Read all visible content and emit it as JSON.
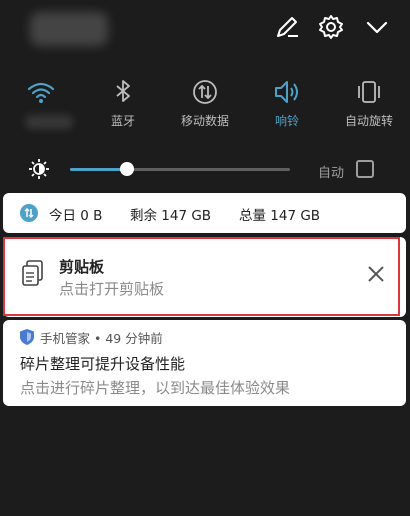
{
  "quick_settings": {
    "tiles": [
      {
        "label": "",
        "icon": "wifi-icon",
        "active": true
      },
      {
        "label": "蓝牙",
        "icon": "bluetooth-icon",
        "active": false
      },
      {
        "label": "移动数据",
        "icon": "mobile-data-icon",
        "active": false
      },
      {
        "label": "响铃",
        "icon": "speaker-icon",
        "active": true
      },
      {
        "label": "自动旋转",
        "icon": "rotate-icon",
        "active": false
      }
    ]
  },
  "brightness": {
    "level": 0.26,
    "auto_label": "自动",
    "auto_checked": false
  },
  "data_usage": {
    "today": "今日 0 B",
    "remaining": "剩余 147 GB",
    "total": "总量 147 GB"
  },
  "clipboard_notification": {
    "title": "剪贴板",
    "subtitle": "点击打开剪贴板"
  },
  "manager_notification": {
    "app": "手机管家",
    "time": "49 分钟前",
    "separator": "•",
    "title": "碎片整理可提升设备性能",
    "body": "点击进行碎片整理，以到达最佳体验效果"
  },
  "colors": {
    "accent": "#4ea1c8",
    "highlight_outline": "#d9363e",
    "shade_background": "#1c1c1c"
  }
}
